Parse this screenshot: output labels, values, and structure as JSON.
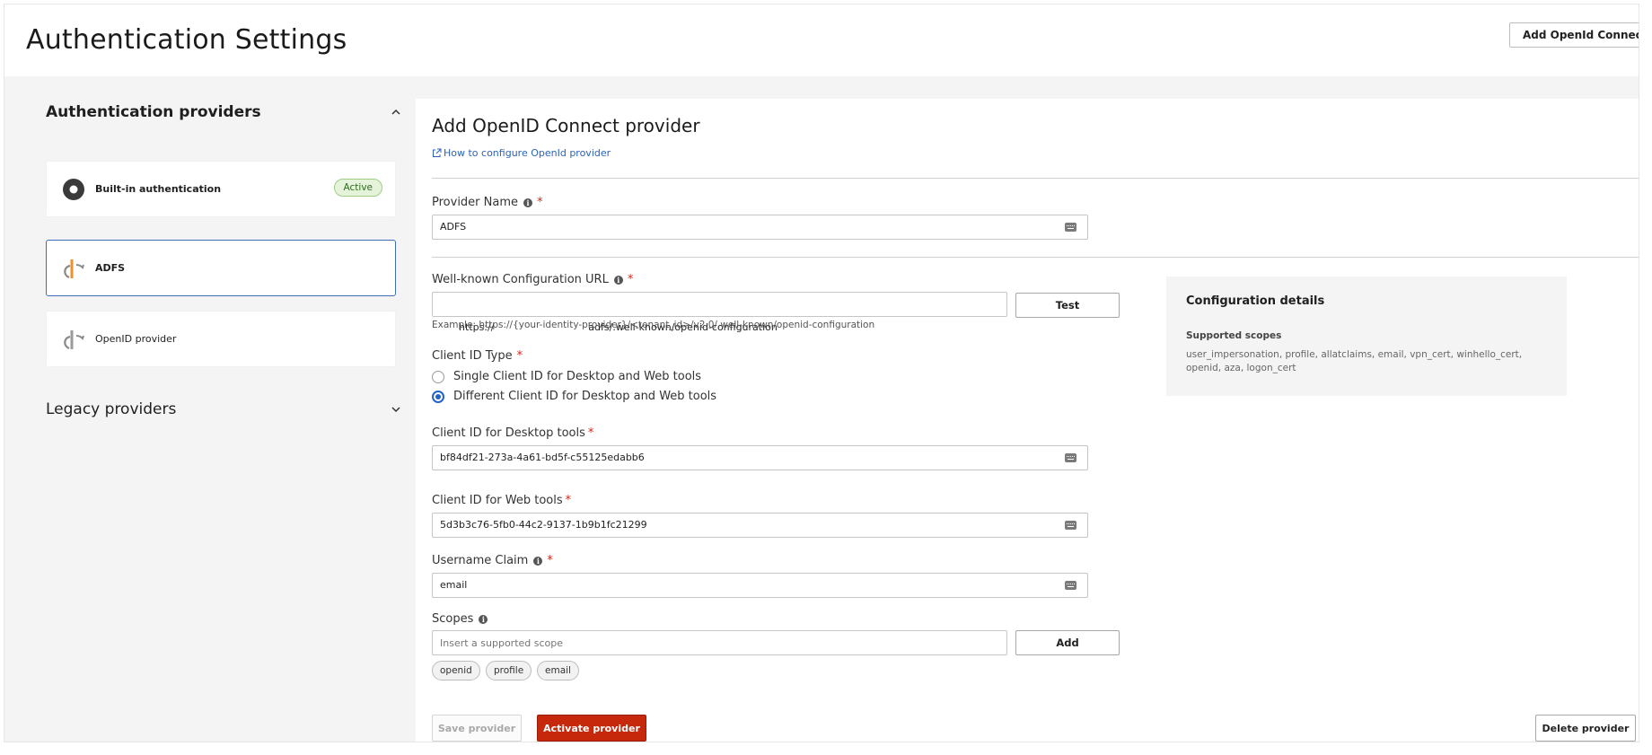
{
  "header": {
    "title": "Authentication Settings",
    "add_button_label": "Add OpenId Connect Provider"
  },
  "sidebar": {
    "auth_section_title": "Authentication providers",
    "providers": [
      {
        "name": "Built-in authentication",
        "badge": "Active",
        "icon": "builtin-auth-icon"
      },
      {
        "name": "ADFS",
        "icon": "openid-icon",
        "selected": true
      },
      {
        "name": "OpenID provider",
        "icon": "openid-icon"
      }
    ],
    "legacy_section_title": "Legacy providers"
  },
  "main": {
    "title": "Add OpenID Connect provider",
    "help_link": "How to configure OpenId provider",
    "provider_name": {
      "label": "Provider Name",
      "value": "ADFS"
    },
    "well_known": {
      "label": "Well-known Configuration URL",
      "value": "https://                              adfs/.well-known/openid-configuration",
      "test_label": "Test",
      "example": "Example: https://{your-identity-provider}/<tenant_id>/v2.0/.well-known/openid-configuration"
    },
    "client_id_type": {
      "label": "Client ID Type",
      "options": [
        {
          "label": "Single Client ID for Desktop and Web tools",
          "selected": false
        },
        {
          "label": "Different Client ID for Desktop and Web tools",
          "selected": true
        }
      ]
    },
    "client_id_desktop": {
      "label": "Client ID for Desktop tools",
      "value": "bf84df21-273a-4a61-bd5f-c55125edabb6"
    },
    "client_id_web": {
      "label": "Client ID for Web tools",
      "value": "5d3b3c76-5fb0-44c2-9137-1b9b1fc21299"
    },
    "username_claim": {
      "label": "Username Claim",
      "value": "email"
    },
    "scopes": {
      "label": "Scopes",
      "placeholder": "Insert a supported scope",
      "add_label": "Add",
      "chips": [
        "openid",
        "profile",
        "email"
      ]
    },
    "config_details": {
      "title": "Configuration details",
      "supported_label": "Supported scopes",
      "supported_text": "user_impersonation, profile, allatclaims, email, vpn_cert, winhello_cert, openid, aza, logon_cert"
    },
    "actions": {
      "save_label": "Save provider",
      "activate_label": "Activate provider",
      "delete_label": "Delete provider"
    }
  },
  "colors": {
    "accent": "#2563c9",
    "danger": "#c6280c",
    "active_badge": "#e4f3d9",
    "selected_border": "#3d6fb6"
  }
}
